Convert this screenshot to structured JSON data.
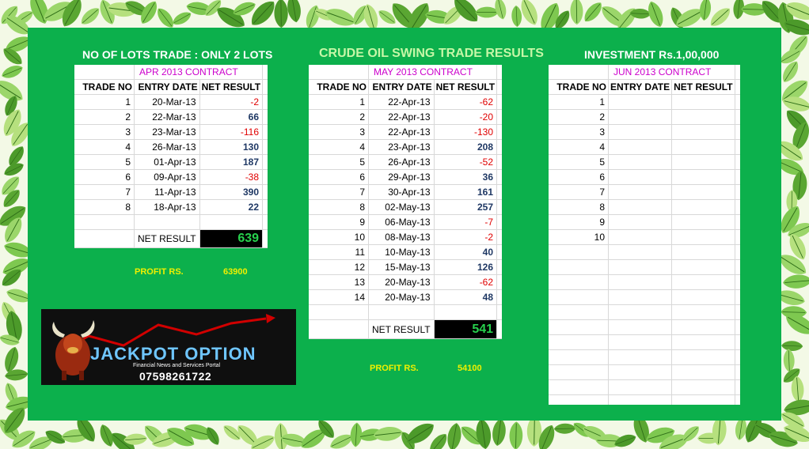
{
  "header": {
    "left": "NO OF LOTS TRADE : ONLY 2 LOTS",
    "center": "CRUDE OIL SWING TRADE RESULTS",
    "right": "INVESTMENT  Rs.1,00,000"
  },
  "columns": [
    "TRADE NO",
    "ENTRY DATE",
    "NET RESULT"
  ],
  "tables": [
    {
      "contract": "APR 2013 CONTRACT",
      "rows": [
        [
          "1",
          "20-Mar-13",
          "-2"
        ],
        [
          "2",
          "22-Mar-13",
          "66"
        ],
        [
          "3",
          "23-Mar-13",
          "-116"
        ],
        [
          "4",
          "26-Mar-13",
          "130"
        ],
        [
          "5",
          "01-Apr-13",
          "187"
        ],
        [
          "6",
          "09-Apr-13",
          "-38"
        ],
        [
          "7",
          "11-Apr-13",
          "390"
        ],
        [
          "8",
          "18-Apr-13",
          "22"
        ]
      ],
      "net_label": "NET RESULT",
      "net_value": "639",
      "profit_label": "PROFIT RS.",
      "profit_value": "63900"
    },
    {
      "contract": "MAY 2013 CONTRACT",
      "rows": [
        [
          "1",
          "22-Apr-13",
          "-62"
        ],
        [
          "2",
          "22-Apr-13",
          "-20"
        ],
        [
          "3",
          "22-Apr-13",
          "-130"
        ],
        [
          "4",
          "23-Apr-13",
          "208"
        ],
        [
          "5",
          "26-Apr-13",
          "-52"
        ],
        [
          "6",
          "29-Apr-13",
          "36"
        ],
        [
          "7",
          "30-Apr-13",
          "161"
        ],
        [
          "8",
          "02-May-13",
          "257"
        ],
        [
          "9",
          "06-May-13",
          "-7"
        ],
        [
          "10",
          "08-May-13",
          "-2"
        ],
        [
          "11",
          "10-May-13",
          "40"
        ],
        [
          "12",
          "15-May-13",
          "126"
        ],
        [
          "13",
          "20-May-13",
          "-62"
        ],
        [
          "14",
          "20-May-13",
          "48"
        ]
      ],
      "net_label": "NET RESULT",
      "net_value": "541",
      "profit_label": "PROFIT RS.",
      "profit_value": "54100"
    },
    {
      "contract": "JUN 2013 CONTRACT",
      "rows": [
        [
          "1",
          "",
          ""
        ],
        [
          "2",
          "",
          ""
        ],
        [
          "3",
          "",
          ""
        ],
        [
          "4",
          "",
          ""
        ],
        [
          "5",
          "",
          ""
        ],
        [
          "6",
          "",
          ""
        ],
        [
          "7",
          "",
          ""
        ],
        [
          "8",
          "",
          ""
        ],
        [
          "9",
          "",
          ""
        ],
        [
          "10",
          "",
          ""
        ]
      ]
    }
  ],
  "logo": {
    "name": "JACKPOT OPTION",
    "tagline": "Financial News and Services Portal",
    "phone": "07598261722"
  },
  "colors": {
    "panel": "#0cb04c",
    "contract_title": "#cc00cc",
    "positive": "#1f3864",
    "negative": "#e00000",
    "net_value": "#27d14d",
    "profit_text": "#f0f000"
  }
}
